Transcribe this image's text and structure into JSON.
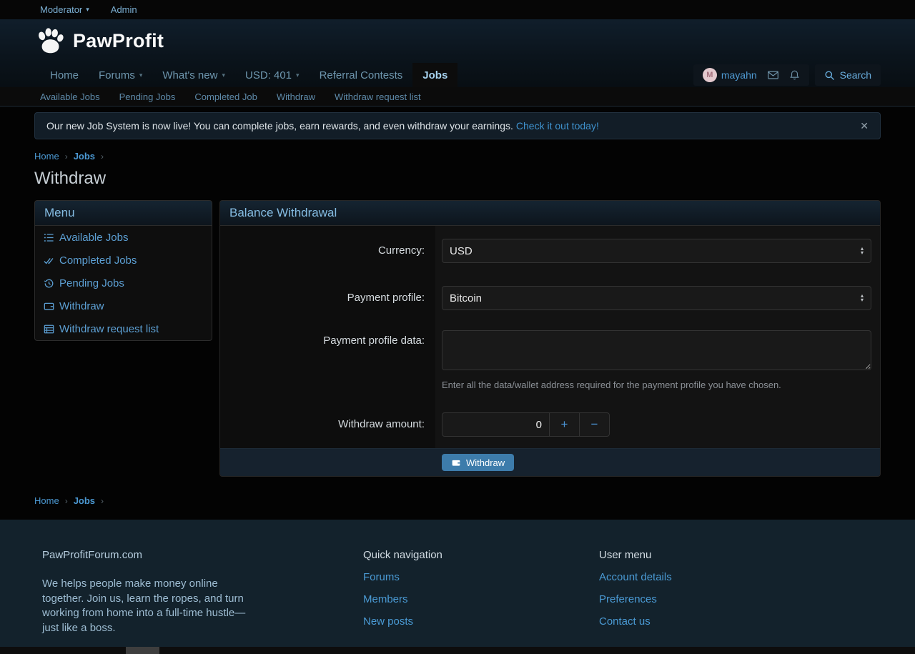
{
  "glyphs": {
    "caret": "▾",
    "chevron": "›",
    "close": "✕",
    "plus": "+",
    "minus": "−",
    "spinner_up": "▴",
    "spinner_down": "▾"
  },
  "topbar": {
    "moderator": "Moderator",
    "admin": "Admin"
  },
  "brand": {
    "name": "PawProfit"
  },
  "nav": {
    "home": "Home",
    "forums": "Forums",
    "whats_new": "What's new",
    "balance": "USD: 401",
    "referral": "Referral Contests",
    "jobs": "Jobs",
    "avatar_letter": "M",
    "username": "mayahn",
    "search": "Search"
  },
  "subnav": {
    "available": "Available Jobs",
    "pending": "Pending Jobs",
    "completed": "Completed Job",
    "withdraw": "Withdraw",
    "request_list": "Withdraw request list"
  },
  "notice": {
    "message": "Our new Job System is now live! You can complete jobs, earn rewards, and even withdraw your earnings.",
    "link": "Check it out today!"
  },
  "breadcrumb": {
    "home": "Home",
    "jobs": "Jobs"
  },
  "page": {
    "title": "Withdraw"
  },
  "menu": {
    "title": "Menu",
    "items": [
      {
        "icon": "list-icon",
        "label": "Available Jobs"
      },
      {
        "icon": "double-check-icon",
        "label": "Completed Jobs"
      },
      {
        "icon": "history-icon",
        "label": "Pending Jobs"
      },
      {
        "icon": "wallet-icon",
        "label": "Withdraw"
      },
      {
        "icon": "table-icon",
        "label": "Withdraw request list"
      }
    ]
  },
  "form": {
    "title": "Balance Withdrawal",
    "currency_label": "Currency:",
    "currency_value": "USD",
    "profile_label": "Payment profile:",
    "profile_value": "Bitcoin",
    "data_label": "Payment profile data:",
    "data_value": "",
    "data_hint": "Enter all the data/wallet address required for the payment profile you have chosen.",
    "amount_label": "Withdraw amount:",
    "amount_value": "0",
    "submit": "Withdraw"
  },
  "footer": {
    "site_title": "PawProfitForum.com",
    "description": "We helps people make money online together. Join us, learn the ropes, and turn working from home into a full-time hustle—just like a boss.",
    "quick_nav_title": "Quick navigation",
    "quick_nav": [
      "Forums",
      "Members",
      "New posts"
    ],
    "user_menu_title": "User menu",
    "user_menu": [
      "Account details",
      "Preferences",
      "Contact us"
    ]
  },
  "colors": {
    "accent": "#4b98d2",
    "button": "#3d7cab",
    "notice_bg": "#121d27",
    "footer_bg": "#13222c",
    "avatar_bg": "#e3c9ce"
  }
}
